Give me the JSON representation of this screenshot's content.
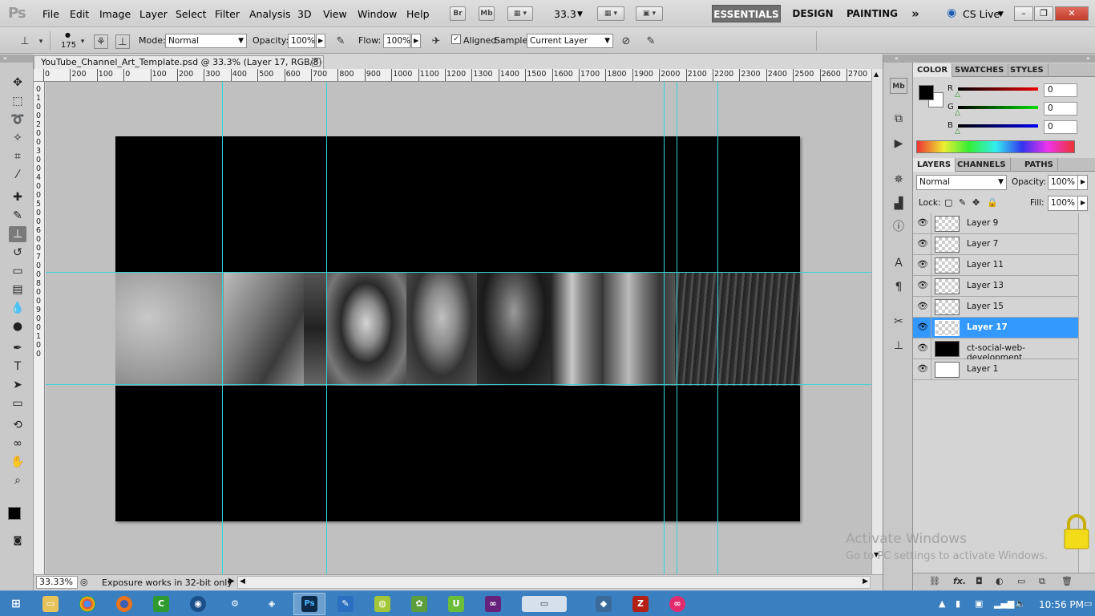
{
  "menubar": {
    "logo": "Ps",
    "menus": [
      "File",
      "Edit",
      "Image",
      "Layer",
      "Select",
      "Filter",
      "Analysis",
      "3D",
      "View",
      "Window",
      "Help"
    ],
    "bridge_btn": "Br",
    "minibridge_btn": "Mb",
    "zoom_value": "33.3",
    "workspaces": [
      "ESSENTIALS",
      "DESIGN",
      "PAINTING"
    ],
    "more_workspaces": "»",
    "cs_live": "CS Live"
  },
  "options": {
    "brush_size": "175",
    "mode_label": "Mode:",
    "mode_value": "Normal",
    "opacity_label": "Opacity:",
    "opacity_value": "100%",
    "flow_label": "Flow:",
    "flow_value": "100%",
    "aligned_label": "Aligned",
    "sample_label": "Sample:",
    "sample_value": "Current Layer"
  },
  "document": {
    "tab_title": "YouTube_Channel_Art_Template.psd @ 33.3% (Layer 17, RGB/8)",
    "ruler_top": [
      "0",
      "200",
      "100",
      "0",
      "100",
      "200",
      "300",
      "400",
      "500",
      "600",
      "700",
      "800",
      "900",
      "1000",
      "1100",
      "1200",
      "1300",
      "1400",
      "1500",
      "1600",
      "1700",
      "1800",
      "1900",
      "2000",
      "2100",
      "2200",
      "2300",
      "2400",
      "2500",
      "2600",
      "2700"
    ],
    "ruler_left": [
      "0",
      "1",
      "0",
      "0",
      "2",
      "0",
      "0",
      "3",
      "0",
      "0",
      "4",
      "0",
      "0",
      "5",
      "0",
      "0",
      "6",
      "0",
      "0",
      "7",
      "0",
      "0",
      "8",
      "0",
      "0",
      "9",
      "0",
      "0",
      "1",
      "0",
      "0"
    ]
  },
  "status": {
    "zoom": "33.33%",
    "message": "Exposure works in 32-bit only"
  },
  "color_panel": {
    "tabs": [
      "COLOR",
      "SWATCHES",
      "STYLES"
    ],
    "channels": [
      {
        "label": "R",
        "value": "0",
        "color": "#d02020"
      },
      {
        "label": "G",
        "value": "0",
        "color": "#20c020"
      },
      {
        "label": "B",
        "value": "0",
        "color": "#2020d0"
      }
    ]
  },
  "layers_panel": {
    "tabs": [
      "LAYERS",
      "CHANNELS",
      "PATHS"
    ],
    "blend_mode": "Normal",
    "opacity_label": "Opacity:",
    "opacity_value": "100%",
    "lock_label": "Lock:",
    "fill_label": "Fill:",
    "fill_value": "100%",
    "layers": [
      {
        "name": "Layer 9"
      },
      {
        "name": "Layer 7"
      },
      {
        "name": "Layer 11"
      },
      {
        "name": "Layer 13"
      },
      {
        "name": "Layer 15"
      },
      {
        "name": "Layer 17"
      },
      {
        "name": "ct-social-web-development"
      },
      {
        "name": "Layer 1"
      }
    ]
  },
  "watermark": {
    "line1": "Activate Windows",
    "line2": "Go to PC settings to activate Windows."
  },
  "taskbar": {
    "photoshop_label": "Ps",
    "clock": "10:56 PM"
  }
}
